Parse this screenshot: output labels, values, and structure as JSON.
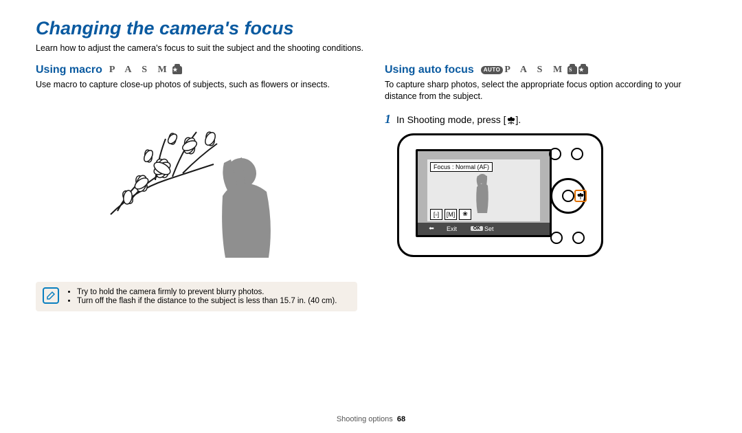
{
  "page": {
    "title": "Changing the camera's focus",
    "intro": "Learn how to adjust the camera's focus to suit the subject and the shooting conditions."
  },
  "left": {
    "heading": "Using macro",
    "modes": "P A S M",
    "body": "Use macro to capture close-up photos of subjects, such as flowers or insects.",
    "note_icon": "pencil-note",
    "tips": [
      "Try to hold the camera firmly to prevent blurry photos.",
      "Turn off the flash if the distance to the subject is less than 15.7 in. (40 cm)."
    ]
  },
  "right": {
    "heading": "Using auto focus",
    "auto_badge": "AUTO",
    "modes": "P A S M",
    "body": "To capture sharp photos, select the appropriate focus option according to your distance from the subject.",
    "step_number": "1",
    "step_text_before": "In Shooting mode, press [",
    "step_text_after": "].",
    "step_icon": "macro-flower",
    "camera": {
      "screen_label": "Focus : Normal (AF)",
      "exit_key": "⬅",
      "exit_label": "Exit",
      "set_key": "OK",
      "set_label": "Set",
      "focus_options": [
        "AF",
        "MF",
        "macro"
      ]
    }
  },
  "footer": {
    "section": "Shooting options",
    "page_number": "68"
  }
}
